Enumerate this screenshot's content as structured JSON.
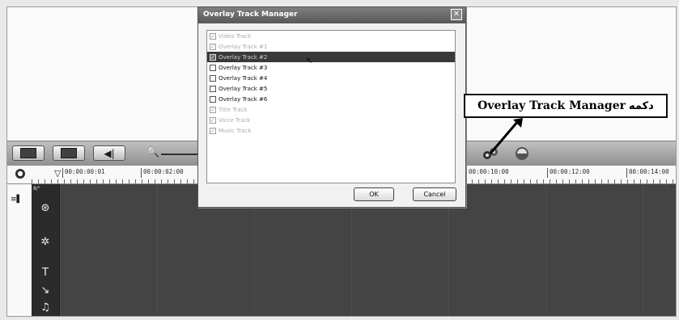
{
  "dialog": {
    "title": "Overlay Track Manager",
    "close_glyph": "✕",
    "tracks": [
      {
        "label": "Video Track",
        "checked": true,
        "enabled": false,
        "selected": false
      },
      {
        "label": "Overlay Track #1",
        "checked": true,
        "enabled": false,
        "selected": false
      },
      {
        "label": "Overlay Track #2",
        "checked": true,
        "enabled": true,
        "selected": true
      },
      {
        "label": "Overlay Track #3",
        "checked": false,
        "enabled": true,
        "selected": false
      },
      {
        "label": "Overlay Track #4",
        "checked": false,
        "enabled": true,
        "selected": false
      },
      {
        "label": "Overlay Track #5",
        "checked": false,
        "enabled": true,
        "selected": false
      },
      {
        "label": "Overlay Track #6",
        "checked": false,
        "enabled": true,
        "selected": false
      },
      {
        "label": "Title Track",
        "checked": true,
        "enabled": false,
        "selected": false
      },
      {
        "label": "Voice Track",
        "checked": true,
        "enabled": false,
        "selected": false
      },
      {
        "label": "Music Track",
        "checked": true,
        "enabled": false,
        "selected": false
      }
    ],
    "ok_label": "OK",
    "cancel_label": "Cancel"
  },
  "callout": {
    "english": "Overlay Track Manager",
    "persian": "دکمه"
  },
  "ruler": {
    "timecodes": [
      "00:00:00:01",
      "00:00:02:00",
      "00:00:10:00",
      "00:00:12:00",
      "00:00:14:00"
    ]
  },
  "toolbar": {
    "zoom_glyph": "🔍"
  },
  "timeline": {
    "header_label": "8/\" "
  },
  "colors": {
    "timeline_bg": "#474747",
    "selection": "#3c3c3c",
    "dialog_title": "#5a5a5a"
  }
}
